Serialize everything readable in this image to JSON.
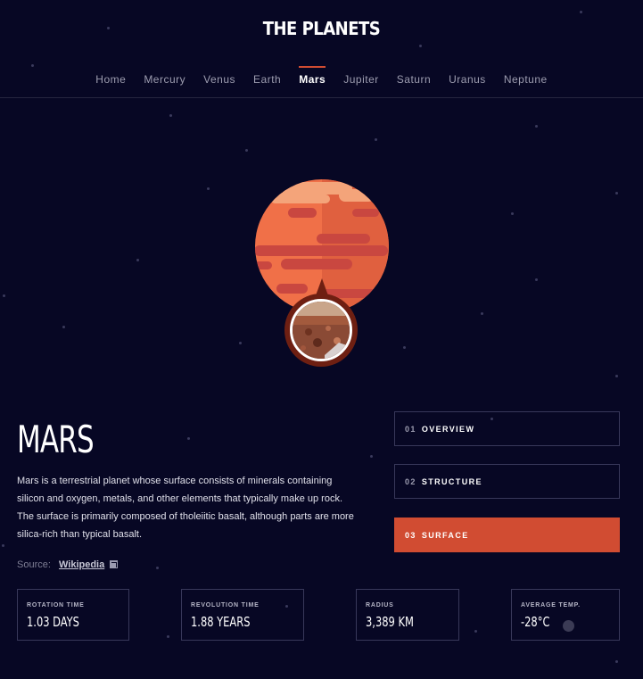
{
  "site": {
    "title": "THE PLANETS"
  },
  "nav": {
    "items": [
      "Home",
      "Mercury",
      "Venus",
      "Earth",
      "Mars",
      "Jupiter",
      "Saturn",
      "Uranus",
      "Neptune"
    ],
    "active": "Mars"
  },
  "planet": {
    "name": "MARS",
    "description": "Mars is a terrestrial planet whose surface consists of minerals containing silicon and oxygen, metals, and other elements that typically make up rock. The surface is primarily composed of tholeiitic basalt, although parts are more silica-rich than typical basalt.",
    "source_label": "Source:",
    "source_link": "Wikipedia"
  },
  "tabs": [
    {
      "num": "01",
      "label": "OVERVIEW"
    },
    {
      "num": "02",
      "label": "STRUCTURE"
    },
    {
      "num": "03",
      "label": "SURFACE"
    }
  ],
  "active_tab": "SURFACE",
  "stats": [
    {
      "label": "ROTATION TIME",
      "value": "1.03 DAYS"
    },
    {
      "label": "REVOLUTION TIME",
      "value": "1.88 YEARS"
    },
    {
      "label": "RADIUS",
      "value": "3,389 KM"
    },
    {
      "label": "AVERAGE TEMP.",
      "value": "-28°C"
    }
  ],
  "colors": {
    "background": "#070724",
    "accent": "#d14c32",
    "planet": "#e86a44",
    "border": "#38385a"
  },
  "icons": {
    "source": "external-link-icon"
  }
}
